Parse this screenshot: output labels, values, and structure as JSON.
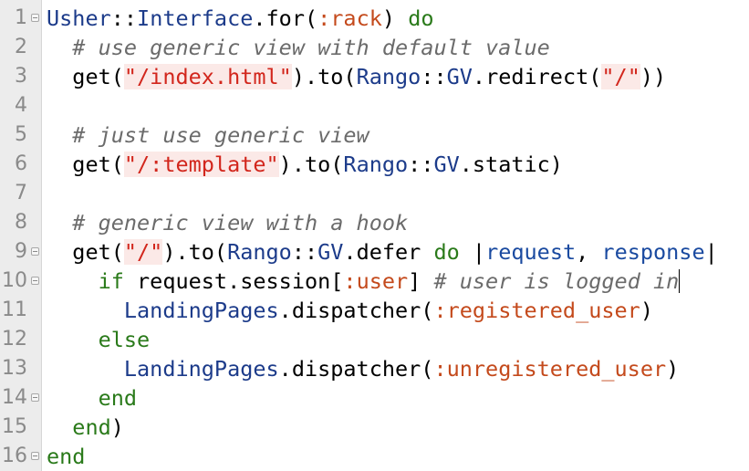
{
  "editor": {
    "gutter": [
      {
        "number": "1",
        "fold": true
      },
      {
        "number": "2",
        "fold": false
      },
      {
        "number": "3",
        "fold": false
      },
      {
        "number": "4",
        "fold": false
      },
      {
        "number": "5",
        "fold": false
      },
      {
        "number": "6",
        "fold": false
      },
      {
        "number": "7",
        "fold": false
      },
      {
        "number": "8",
        "fold": false
      },
      {
        "number": "9",
        "fold": true
      },
      {
        "number": "10",
        "fold": true
      },
      {
        "number": "11",
        "fold": false
      },
      {
        "number": "12",
        "fold": false
      },
      {
        "number": "13",
        "fold": false
      },
      {
        "number": "14",
        "fold": true
      },
      {
        "number": "15",
        "fold": false
      },
      {
        "number": "16",
        "fold": true
      }
    ],
    "lines": [
      [
        [
          "const",
          "Usher"
        ],
        [
          "plain",
          "::"
        ],
        [
          "const",
          "Interface"
        ],
        [
          "plain",
          ".for("
        ],
        [
          "sym",
          ":rack"
        ],
        [
          "plain",
          ") "
        ],
        [
          "kw",
          "do"
        ]
      ],
      [
        [
          "plain",
          "  "
        ],
        [
          "comment",
          "# use generic view with default value"
        ]
      ],
      [
        [
          "plain",
          "  get("
        ],
        [
          "str",
          "\"/index.html\""
        ],
        [
          "plain",
          ").to("
        ],
        [
          "const",
          "Rango"
        ],
        [
          "plain",
          "::"
        ],
        [
          "const",
          "GV"
        ],
        [
          "plain",
          ".redirect("
        ],
        [
          "str",
          "\"/\""
        ],
        [
          "plain",
          "))"
        ]
      ],
      [],
      [
        [
          "plain",
          "  "
        ],
        [
          "comment",
          "# just use generic view"
        ]
      ],
      [
        [
          "plain",
          "  get("
        ],
        [
          "str",
          "\"/:template\""
        ],
        [
          "plain",
          ").to("
        ],
        [
          "const",
          "Rango"
        ],
        [
          "plain",
          "::"
        ],
        [
          "const",
          "GV"
        ],
        [
          "plain",
          ".static)"
        ]
      ],
      [],
      [
        [
          "plain",
          "  "
        ],
        [
          "comment",
          "# generic view with a hook"
        ]
      ],
      [
        [
          "plain",
          "  get("
        ],
        [
          "str",
          "\"/\""
        ],
        [
          "plain",
          ").to("
        ],
        [
          "const",
          "Rango"
        ],
        [
          "plain",
          "::"
        ],
        [
          "const",
          "GV"
        ],
        [
          "plain",
          ".defer "
        ],
        [
          "kw",
          "do"
        ],
        [
          "plain",
          " |"
        ],
        [
          "blockvar",
          "request"
        ],
        [
          "plain",
          ", "
        ],
        [
          "blockvar",
          "response"
        ],
        [
          "plain",
          "|"
        ]
      ],
      [
        [
          "plain",
          "    "
        ],
        [
          "kw",
          "if"
        ],
        [
          "plain",
          " request.session["
        ],
        [
          "sym",
          ":user"
        ],
        [
          "plain",
          "] "
        ],
        [
          "comment",
          "# user is logged in"
        ],
        [
          "caret",
          ""
        ]
      ],
      [
        [
          "plain",
          "      "
        ],
        [
          "const",
          "LandingPages"
        ],
        [
          "plain",
          ".dispatcher("
        ],
        [
          "sym",
          ":registered_user"
        ],
        [
          "plain",
          ")"
        ]
      ],
      [
        [
          "plain",
          "    "
        ],
        [
          "kw",
          "else"
        ]
      ],
      [
        [
          "plain",
          "      "
        ],
        [
          "const",
          "LandingPages"
        ],
        [
          "plain",
          ".dispatcher("
        ],
        [
          "sym",
          ":unregistered_user"
        ],
        [
          "plain",
          ")"
        ]
      ],
      [
        [
          "plain",
          "    "
        ],
        [
          "kw",
          "end"
        ]
      ],
      [
        [
          "plain",
          "  "
        ],
        [
          "kw",
          "end"
        ],
        [
          "plain",
          ")"
        ]
      ],
      [
        [
          "kw",
          "end"
        ]
      ]
    ],
    "colors": {
      "background": "#ffffff",
      "gutter_background": "#ececec",
      "line_number": "#8a8a8a",
      "constant": "#1c3b8a",
      "keyword": "#2a7a1a",
      "symbol": "#c44a1c",
      "string": "#d2261c",
      "string_background": "#fbe9e7",
      "comment": "#6b6b6b",
      "block_variable": "#1a4aa0"
    }
  }
}
